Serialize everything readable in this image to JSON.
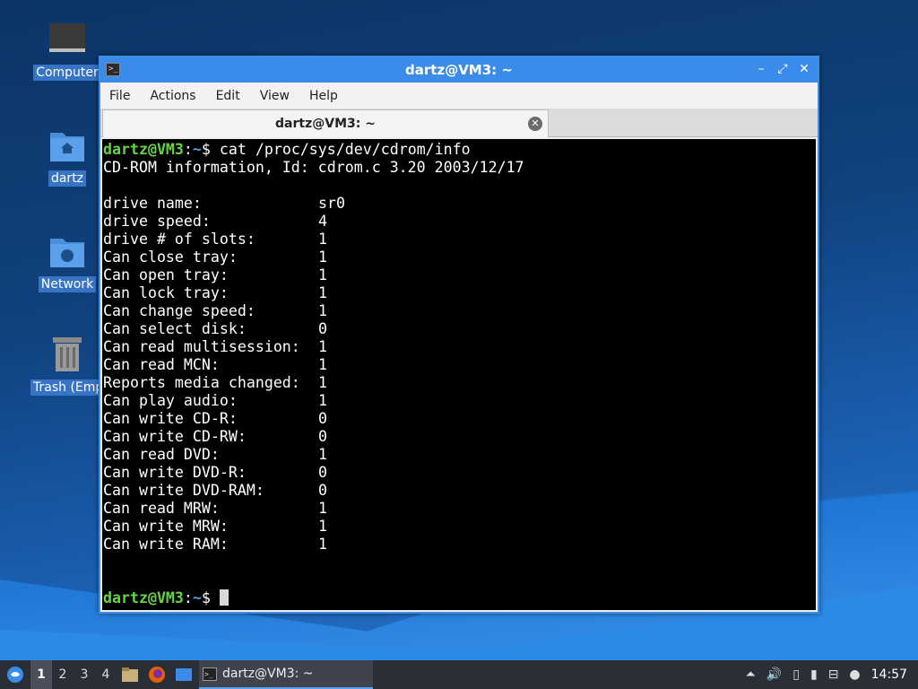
{
  "desktop": {
    "icons": [
      {
        "label": "Computer"
      },
      {
        "label": "dartz"
      },
      {
        "label": "Network"
      },
      {
        "label": "Trash (Empty)"
      }
    ]
  },
  "window": {
    "title": "dartz@VM3: ~",
    "menu": [
      "File",
      "Actions",
      "Edit",
      "View",
      "Help"
    ],
    "tab_label": "dartz@VM3: ~"
  },
  "terminal": {
    "prompt_user": "dartz@VM3",
    "prompt_sep": ":",
    "prompt_path": "~",
    "prompt_symbol": "$ ",
    "command": "cat /proc/sys/dev/cdrom/info",
    "header": "CD-ROM information, Id: cdrom.c 3.20 2003/12/17",
    "rows": [
      {
        "key": "drive name:",
        "value": "sr0"
      },
      {
        "key": "drive speed:",
        "value": "4"
      },
      {
        "key": "drive # of slots:",
        "value": "1"
      },
      {
        "key": "Can close tray:",
        "value": "1"
      },
      {
        "key": "Can open tray:",
        "value": "1"
      },
      {
        "key": "Can lock tray:",
        "value": "1"
      },
      {
        "key": "Can change speed:",
        "value": "1"
      },
      {
        "key": "Can select disk:",
        "value": "0"
      },
      {
        "key": "Can read multisession:",
        "value": "1"
      },
      {
        "key": "Can read MCN:",
        "value": "1"
      },
      {
        "key": "Reports media changed:",
        "value": "1"
      },
      {
        "key": "Can play audio:",
        "value": "1"
      },
      {
        "key": "Can write CD-R:",
        "value": "0"
      },
      {
        "key": "Can write CD-RW:",
        "value": "0"
      },
      {
        "key": "Can read DVD:",
        "value": "1"
      },
      {
        "key": "Can write DVD-R:",
        "value": "0"
      },
      {
        "key": "Can write DVD-RAM:",
        "value": "0"
      },
      {
        "key": "Can read MRW:",
        "value": "1"
      },
      {
        "key": "Can write MRW:",
        "value": "1"
      },
      {
        "key": "Can write RAM:",
        "value": "1"
      }
    ]
  },
  "taskbar": {
    "workspaces": [
      "1",
      "2",
      "3",
      "4"
    ],
    "active_task": "dartz@VM3: ~",
    "clock": "14:57"
  }
}
